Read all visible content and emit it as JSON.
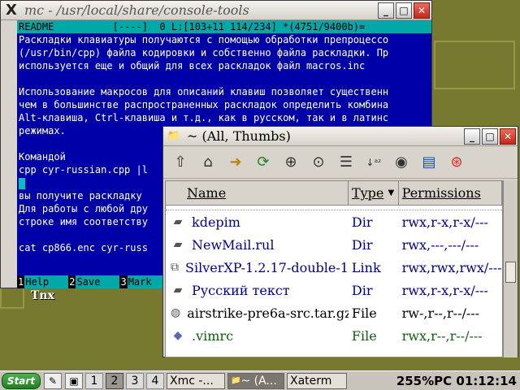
{
  "desktop": {
    "label": "Tnx"
  },
  "mc_window": {
    "title": "mc - /usr/local/share/console-tools",
    "status": "README          [----]  0 L:[103+11 114/234] *(4751/9400b)=",
    "lines": [
      "Раскладки клавиатуры получаются с помощью обработки препроцессо",
      "(/usr/bin/cpp) файла кодировки и собственно файла раскладки. Пр",
      "используется еще и общий для всех раскладок файл macros.inc",
      "",
      "Использование макросов для описаний клавиш позволяет существенн",
      "чем в большинстве распространенных раскладок определить комбина",
      "Alt-клавиша, Ctrl-клавиша и т.д., как в русском, так и в латинс",
      "режимах.",
      "",
      "Командой",
      "cpp cyr-russian.cpp |l",
      "",
      "вы получите раскладку",
      "Для работы с любой дру",
      "строке имя соответству",
      "",
      "cat cp866.enc cyr-russ"
    ],
    "fkeys": [
      {
        "num": "1",
        "label": "Help"
      },
      {
        "num": "2",
        "label": "Save"
      },
      {
        "num": "3",
        "label": "Mark"
      }
    ]
  },
  "fm_window": {
    "title": "~ (All, Thumbs)",
    "toolbar": [
      "up-arrow-icon",
      "home-icon",
      "go-icon",
      "refresh-icon",
      "zoom-in-icon",
      "zoom-fit-icon",
      "list-view-icon",
      "sort-az-icon",
      "eye-icon",
      "details-icon",
      "help-icon"
    ],
    "columns": {
      "name": "Name",
      "type": "Type",
      "permissions": "Permissions"
    },
    "rows": [
      {
        "name": "kdepim",
        "type": "Dir",
        "perm": "rwx,r-x,r-x/---",
        "icon": "folder-icon",
        "color": "#000088"
      },
      {
        "name": "NewMail.rul",
        "type": "Dir",
        "perm": "rwx,---,---/---",
        "icon": "folder-icon",
        "color": "#000088"
      },
      {
        "name": "SilverXP-1.2.17-double-1",
        "type": "Link",
        "perm": "rwx,rwx,rwx/---",
        "icon": "link-icon",
        "color": "#000088"
      },
      {
        "name": "Русский текст",
        "type": "Dir",
        "perm": "rwx,r-x,r-x/---",
        "icon": "folder-icon",
        "color": "#000088"
      },
      {
        "name": "airstrike-pre6a-src.tar.gz",
        "type": "File",
        "perm": "rw-,r--,r--/---",
        "icon": "archive-icon",
        "color": "#000000"
      },
      {
        "name": ".vimrc",
        "type": "File",
        "perm": "rwx,r--,r--/---",
        "icon": "file-icon",
        "color": "#106010"
      }
    ]
  },
  "taskbar": {
    "start": "Start",
    "desktops": [
      "1",
      "2",
      "3",
      "4"
    ],
    "tasks": [
      "mc -...",
      "~ (A...",
      "aterm"
    ],
    "clock": "255%PC 01:12:14"
  }
}
